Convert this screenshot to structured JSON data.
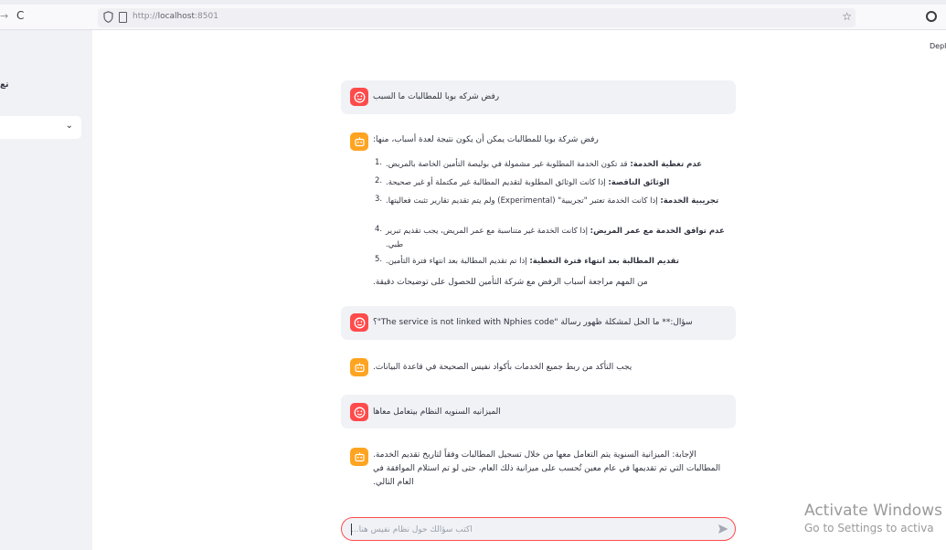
{
  "browser": {
    "url_prefix": "http://",
    "url_host": "localhost",
    "url_port": ":8501",
    "forward_icon": "→",
    "reload_icon": "C"
  },
  "sidebar": {
    "label": "تع",
    "select_chevron": "⌄"
  },
  "header": {
    "deploy_label": "Deplo"
  },
  "chat": {
    "q1": "رفض شركه بوبا للمطالبات ما السبب",
    "a1": {
      "intro": "رفض شركة بوبا للمطالبات يمكن أن يكون نتيجة لعدة أسباب، منها:",
      "items": [
        {
          "num": "1.",
          "bold": "عدم تغطية الخدمة:",
          "text": " قد تكون الخدمة المطلوبة غير مشمولة في بوليصة التأمين الخاصة بالمريض."
        },
        {
          "num": "2.",
          "bold": "الوثائق الناقصة:",
          "text": " إذا كانت الوثائق المطلوبة لتقديم المطالبة غير مكتملة أو غير صحيحة."
        },
        {
          "num": "3.",
          "bold": "تجريبية الخدمة:",
          "text": " إذا كانت الخدمة تعتبر \"تجريبية\" (Experimental) ولم يتم تقديم تقارير تثبت فعاليتها."
        },
        {
          "num": "4.",
          "bold": "عدم توافق الخدمة مع عمر المريض:",
          "text": " إذا كانت الخدمة غير متناسبة مع عمر المريض، يجب تقديم تبرير طبي."
        },
        {
          "num": "5.",
          "bold": "تقديم المطالبة بعد انتهاء فترة التغطية:",
          "text": " إذا تم تقديم المطالبة بعد انتهاء فترة التأمين."
        }
      ],
      "outro": "من المهم مراجعة أسباب الرفض مع شركة التأمين للحصول على توضيحات دقيقة."
    },
    "q2": "سؤال:** ما الحل لمشكلة ظهور رسالة \"The service is not linked with Nphies code\"؟",
    "a2": "يجب التأكد من ربط جميع الخدمات بأكواد نفيس الصحيحة في قاعدة البيانات.",
    "q3": "الميزانيه السنويه النظام بيتعامل معاها",
    "a3": "الإجابة: الميزانية السنوية يتم التعامل معها من خلال تسجيل المطالبات وفقاً لتاريخ تقديم الخدمة. المطالبات التي تم تقديمها في عام معين تُحسب على ميزانية ذلك العام، حتى لو تم استلام الموافقة في العام التالي.",
    "input_placeholder": "اكتب سؤالك حول نظام نفيس هنا..."
  },
  "watermark": {
    "line1": "Activate Windows",
    "line2": "Go to Settings to activa"
  }
}
